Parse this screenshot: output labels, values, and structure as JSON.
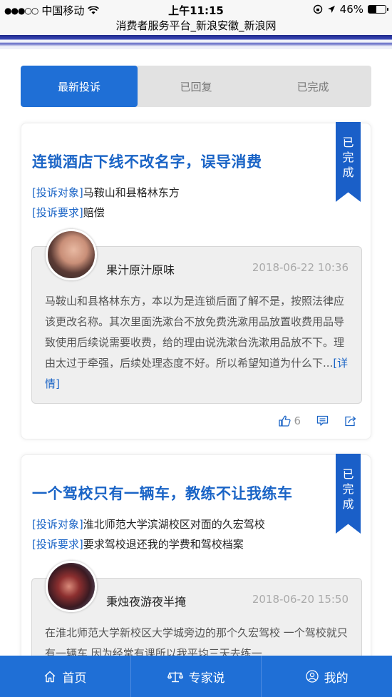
{
  "status_bar": {
    "carrier": "中国移动",
    "time": "上午11:15",
    "battery": "46%",
    "battery_level": 0.46
  },
  "header": {
    "title": "消费者服务平台_新浪安徽_新浪网"
  },
  "tabs": [
    {
      "label": "最新投诉",
      "active": true
    },
    {
      "label": "已回复",
      "active": false
    },
    {
      "label": "已完成",
      "active": false
    }
  ],
  "complaints": [
    {
      "status": [
        "已",
        "完",
        "成"
      ],
      "title": "连锁酒店下线不改名字，误导消费",
      "target_tag": "[投诉对象]",
      "target": "马鞍山和县格林东方",
      "request_tag": "[投诉要求]",
      "request": "赔偿",
      "user": "果汁原汁原味",
      "datetime": "2018-06-22 10:36",
      "content": "马鞍山和县格林东方，本以为是连锁后面了解不是，按照法律应该更改名称。其次里面洗漱台不放免费洗漱用品放置收费用品导致使用后续说需要收费，给的理由说洗漱台洗漱用品放不下。理由太过于牵强，后续处理态度不好。所以希望知道为什么下...",
      "more": "[详情]",
      "likes": "6"
    },
    {
      "status": [
        "已",
        "完",
        "成"
      ],
      "title": "一个驾校只有一辆车，教练不让我练车",
      "target_tag": "[投诉对象]",
      "target": "淮北师范大学滨湖校区对面的久宏驾校",
      "request_tag": "[投诉要求]",
      "request": "要求驾校退还我的学费和驾校档案",
      "user": "秉烛夜游夜半掩",
      "datetime": "2018-06-20 15:50",
      "content": "在淮北师范大学新校区大学城旁边的那个久宏驾校 一个驾校就只有一辆车 因为经常有课所以我平均三天去练一"
    }
  ],
  "bottom_nav": [
    {
      "label": "首页",
      "icon": "home-icon"
    },
    {
      "label": "专家说",
      "icon": "scale-icon"
    },
    {
      "label": "我的",
      "icon": "user-icon"
    }
  ],
  "colors": {
    "accent": "#1f6fd6",
    "link": "#1a64c6",
    "ribbon": "#1a5fc8"
  }
}
